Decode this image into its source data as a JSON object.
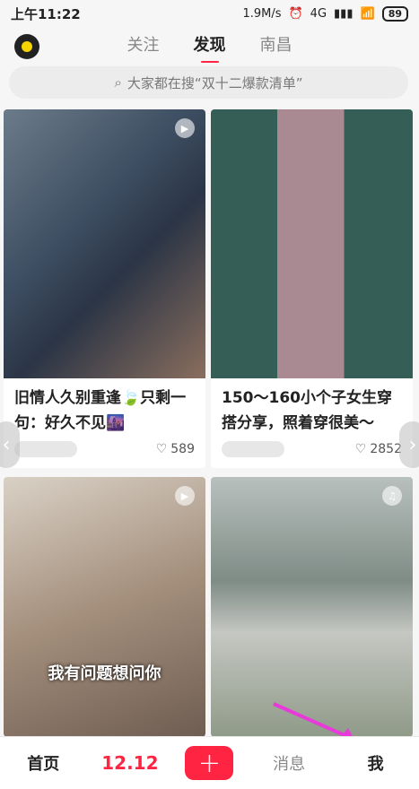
{
  "status": {
    "time": "上午11:22",
    "speed": "1.9M/s",
    "net": "4G",
    "battery": "89"
  },
  "header": {
    "tabs": [
      "关注",
      "发现",
      "南昌"
    ],
    "active_tab": "发现"
  },
  "search": {
    "placeholder": "大家都在搜“双十二爆款清单”"
  },
  "cards": [
    {
      "title": "旧情人久别重逢🍃只剩一句：好久不见🌆",
      "likes": "589",
      "type": "video"
    },
    {
      "title": "150～160小个子女生穿搭分享，照着穿很美～",
      "likes": "2852",
      "type": "image"
    },
    {
      "title": "",
      "subtitle": "我有问题想问你",
      "type": "video"
    },
    {
      "title": "",
      "type": "music"
    }
  ],
  "nav": {
    "home": "首页",
    "promo": "12.12",
    "add": "+",
    "messages": "消息",
    "me": "我"
  },
  "colors": {
    "accent": "#ff2442"
  }
}
